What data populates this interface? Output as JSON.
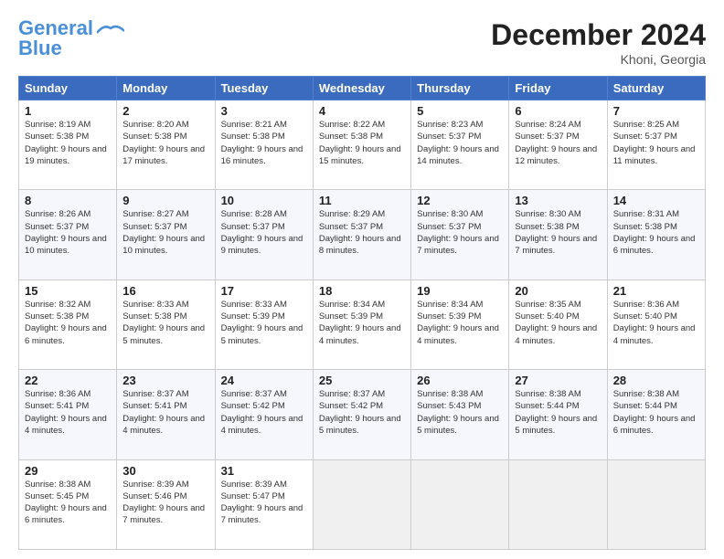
{
  "logo": {
    "line1": "General",
    "line2": "Blue"
  },
  "title": "December 2024",
  "location": "Khoni, Georgia",
  "days_header": [
    "Sunday",
    "Monday",
    "Tuesday",
    "Wednesday",
    "Thursday",
    "Friday",
    "Saturday"
  ],
  "weeks": [
    [
      {
        "day": "1",
        "sunrise": "8:19 AM",
        "sunset": "5:38 PM",
        "daylight": "9 hours and 19 minutes."
      },
      {
        "day": "2",
        "sunrise": "8:20 AM",
        "sunset": "5:38 PM",
        "daylight": "9 hours and 17 minutes."
      },
      {
        "day": "3",
        "sunrise": "8:21 AM",
        "sunset": "5:38 PM",
        "daylight": "9 hours and 16 minutes."
      },
      {
        "day": "4",
        "sunrise": "8:22 AM",
        "sunset": "5:38 PM",
        "daylight": "9 hours and 15 minutes."
      },
      {
        "day": "5",
        "sunrise": "8:23 AM",
        "sunset": "5:37 PM",
        "daylight": "9 hours and 14 minutes."
      },
      {
        "day": "6",
        "sunrise": "8:24 AM",
        "sunset": "5:37 PM",
        "daylight": "9 hours and 12 minutes."
      },
      {
        "day": "7",
        "sunrise": "8:25 AM",
        "sunset": "5:37 PM",
        "daylight": "9 hours and 11 minutes."
      }
    ],
    [
      {
        "day": "8",
        "sunrise": "8:26 AM",
        "sunset": "5:37 PM",
        "daylight": "9 hours and 10 minutes."
      },
      {
        "day": "9",
        "sunrise": "8:27 AM",
        "sunset": "5:37 PM",
        "daylight": "9 hours and 10 minutes."
      },
      {
        "day": "10",
        "sunrise": "8:28 AM",
        "sunset": "5:37 PM",
        "daylight": "9 hours and 9 minutes."
      },
      {
        "day": "11",
        "sunrise": "8:29 AM",
        "sunset": "5:37 PM",
        "daylight": "9 hours and 8 minutes."
      },
      {
        "day": "12",
        "sunrise": "8:30 AM",
        "sunset": "5:37 PM",
        "daylight": "9 hours and 7 minutes."
      },
      {
        "day": "13",
        "sunrise": "8:30 AM",
        "sunset": "5:38 PM",
        "daylight": "9 hours and 7 minutes."
      },
      {
        "day": "14",
        "sunrise": "8:31 AM",
        "sunset": "5:38 PM",
        "daylight": "9 hours and 6 minutes."
      }
    ],
    [
      {
        "day": "15",
        "sunrise": "8:32 AM",
        "sunset": "5:38 PM",
        "daylight": "9 hours and 6 minutes."
      },
      {
        "day": "16",
        "sunrise": "8:33 AM",
        "sunset": "5:38 PM",
        "daylight": "9 hours and 5 minutes."
      },
      {
        "day": "17",
        "sunrise": "8:33 AM",
        "sunset": "5:39 PM",
        "daylight": "9 hours and 5 minutes."
      },
      {
        "day": "18",
        "sunrise": "8:34 AM",
        "sunset": "5:39 PM",
        "daylight": "9 hours and 4 minutes."
      },
      {
        "day": "19",
        "sunrise": "8:34 AM",
        "sunset": "5:39 PM",
        "daylight": "9 hours and 4 minutes."
      },
      {
        "day": "20",
        "sunrise": "8:35 AM",
        "sunset": "5:40 PM",
        "daylight": "9 hours and 4 minutes."
      },
      {
        "day": "21",
        "sunrise": "8:36 AM",
        "sunset": "5:40 PM",
        "daylight": "9 hours and 4 minutes."
      }
    ],
    [
      {
        "day": "22",
        "sunrise": "8:36 AM",
        "sunset": "5:41 PM",
        "daylight": "9 hours and 4 minutes."
      },
      {
        "day": "23",
        "sunrise": "8:37 AM",
        "sunset": "5:41 PM",
        "daylight": "9 hours and 4 minutes."
      },
      {
        "day": "24",
        "sunrise": "8:37 AM",
        "sunset": "5:42 PM",
        "daylight": "9 hours and 4 minutes."
      },
      {
        "day": "25",
        "sunrise": "8:37 AM",
        "sunset": "5:42 PM",
        "daylight": "9 hours and 5 minutes."
      },
      {
        "day": "26",
        "sunrise": "8:38 AM",
        "sunset": "5:43 PM",
        "daylight": "9 hours and 5 minutes."
      },
      {
        "day": "27",
        "sunrise": "8:38 AM",
        "sunset": "5:44 PM",
        "daylight": "9 hours and 5 minutes."
      },
      {
        "day": "28",
        "sunrise": "8:38 AM",
        "sunset": "5:44 PM",
        "daylight": "9 hours and 6 minutes."
      }
    ],
    [
      {
        "day": "29",
        "sunrise": "8:38 AM",
        "sunset": "5:45 PM",
        "daylight": "9 hours and 6 minutes."
      },
      {
        "day": "30",
        "sunrise": "8:39 AM",
        "sunset": "5:46 PM",
        "daylight": "9 hours and 7 minutes."
      },
      {
        "day": "31",
        "sunrise": "8:39 AM",
        "sunset": "5:47 PM",
        "daylight": "9 hours and 7 minutes."
      },
      null,
      null,
      null,
      null
    ]
  ],
  "labels": {
    "sunrise": "Sunrise:",
    "sunset": "Sunset:",
    "daylight": "Daylight:"
  }
}
